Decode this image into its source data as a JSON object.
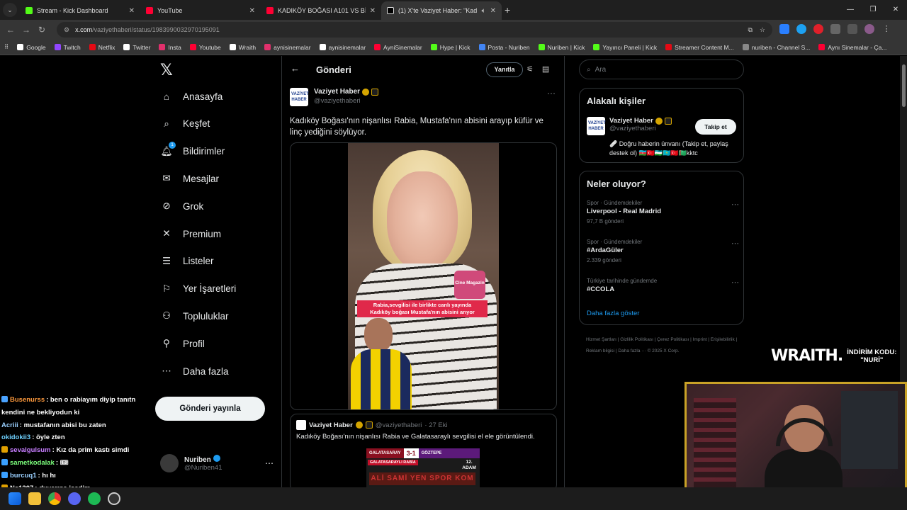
{
  "browser": {
    "tabs": [
      {
        "title": "Stream - Kick Dashboard",
        "color": "#53fc18"
      },
      {
        "title": "YouTube",
        "color": "#ff0033"
      },
      {
        "title": "KADIKÖY BOĞASI A101 VS BİM",
        "color": "#ff0033"
      },
      {
        "title": "(1) X'te Vaziyet Haber: \"Kadı",
        "color": "#ffffff"
      }
    ],
    "url_host": "x.com",
    "url_path": "/vaziyethaberi/status/1983990032970195091",
    "bookmarks": [
      {
        "label": "Google",
        "color": "#ffffff"
      },
      {
        "label": "Twitch",
        "color": "#9146ff"
      },
      {
        "label": "Netflix",
        "color": "#e50914"
      },
      {
        "label": "Twitter",
        "color": "#ffffff"
      },
      {
        "label": "Insta",
        "color": "#e1306c"
      },
      {
        "label": "Youtube",
        "color": "#ff0033"
      },
      {
        "label": "Wraith",
        "color": "#ffffff"
      },
      {
        "label": "aynisinemalar",
        "color": "#e1306c"
      },
      {
        "label": "aynisinemalar",
        "color": "#ffffff"
      },
      {
        "label": "AyniSinemalar",
        "color": "#ff0033"
      },
      {
        "label": "Hype | Kick",
        "color": "#53fc18"
      },
      {
        "label": "Posta - Nuriben",
        "color": "#4285f4"
      },
      {
        "label": "Nuriben | Kick",
        "color": "#53fc18"
      },
      {
        "label": "Yayıncı Paneli | Kick",
        "color": "#53fc18"
      },
      {
        "label": "Streamer Content M...",
        "color": "#e50914"
      },
      {
        "label": "nuriben - Channel S...",
        "color": "#888888"
      },
      {
        "label": "Aynı Sinemalar - Ça...",
        "color": "#ff0033"
      }
    ]
  },
  "left_nav": {
    "items": [
      {
        "label": "Anasayfa",
        "icon": "home-icon",
        "glyph": "⌂"
      },
      {
        "label": "Keşfet",
        "icon": "search-icon",
        "glyph": "⌕"
      },
      {
        "label": "Bildirimler",
        "icon": "bell-icon",
        "glyph": "🔔︎"
      },
      {
        "label": "Mesajlar",
        "icon": "mail-icon",
        "glyph": "✉"
      },
      {
        "label": "Grok",
        "icon": "grok-icon",
        "glyph": "⊘"
      },
      {
        "label": "Premium",
        "icon": "x-premium-icon",
        "glyph": "✕"
      },
      {
        "label": "Listeler",
        "icon": "list-icon",
        "glyph": "☰"
      },
      {
        "label": "Yer İşaretleri",
        "icon": "bookmark-icon",
        "glyph": "⚐"
      },
      {
        "label": "Topluluklar",
        "icon": "communities-icon",
        "glyph": "⚇"
      },
      {
        "label": "Profil",
        "icon": "profile-icon",
        "glyph": "⚲"
      },
      {
        "label": "Daha fazla",
        "icon": "more-circle-icon",
        "glyph": "⋯"
      }
    ],
    "notification_count": "1",
    "post_button": "Gönderi yayınla",
    "user": {
      "name": "Nuriben",
      "handle": "@Nuriben41"
    }
  },
  "post": {
    "header_title": "Gönderi",
    "reply_button": "Yanıtla",
    "author_name": "Vaziyet Haber",
    "author_handle": "@vaziyethaberi",
    "logo_text_1": "VAZİYET",
    "logo_text_2": "HABER",
    "text": "Kadıköy Boğası'nın nişanlısı Rabia, Mustafa'nın abisini arayıp küfür ve linç yediğini söylüyor.",
    "video_caption_1": "Rabia,sevgilisi ile birlikte canlı yayında",
    "video_caption_2": "Kadıköy boğası Mustafa'nın abisini arıyor",
    "video_logo": "Cine Magazin",
    "quoted": {
      "author_name": "Vaziyet Haber",
      "author_handle": "@vaziyethaberi",
      "date": "· 27 Eki",
      "text": "Kadıköy Boğası'nın nişanlısı Rabia ve Galatasaraylı sevgilisi el ele görüntülendi.",
      "home": "GALATASARAY",
      "score": "3-1",
      "away": "GÖZTEPE",
      "sub": "GALATASARAYLI RABİA",
      "adam": "12. ADAM",
      "banner": "ALİ SAMİ YEN SPOR KOM"
    }
  },
  "right": {
    "search_placeholder": "Ara",
    "related_title": "Alakalı kişiler",
    "related_name": "Vaziyet Haber",
    "related_handle": "@vaziyethaberi",
    "follow_button": "Takip et",
    "bio": "🩹 Doğru haberin ünvanı (Takip et, paylaş destek ol) 🇦🇿🇹🇷🇺🇿🇰🇿🇹🇷🇹🇲kktc",
    "trends_title": "Neler oluyor?",
    "trends": [
      {
        "context": "Spor · Gündemdekiler",
        "name": "Liverpool - Real Madrid",
        "count": "97,7 B gönderi"
      },
      {
        "context": "Spor · Gündemdekiler",
        "name": "#ArdaGüler",
        "count": "2.339 gönderi"
      },
      {
        "context": "Türkiye tarihinde gündemde",
        "name": "#CCOLA",
        "count": ""
      }
    ],
    "more_link": "Daha fazla göster",
    "footer": "Hizmet Şartları | Gizlilik Politikası | Çerez Politikası | Imprint | Erişilebilirlik | Reklam bilgisi | Daha fazla ··· © 2025 X Corp."
  },
  "chat": [
    {
      "user": "Busenurss",
      "msg": ": ben o rabiayım diyip tanıtn",
      "color": "#ff9a3c",
      "icon": "#4aa3ff"
    },
    {
      "user": "",
      "msg": "kendini ne bekliyodun ki",
      "color": "#ffffff",
      "icon": ""
    },
    {
      "user": "Acriii",
      "msg": ": mustafanın abisi bu zaten",
      "color": "#9ad0ff",
      "icon": ""
    },
    {
      "user": "okidokii3",
      "msg": ": öyle zten",
      "color": "#6fd1ff",
      "icon": ""
    },
    {
      "user": "sevalgulsum",
      "msg": ": Kız da prim kastı simdi",
      "color": "#c77dff",
      "icon": "#e0a000"
    },
    {
      "user": "sametkodalak",
      "msg": ": 🎟",
      "color": "#7cff7c",
      "icon": "#3aa0ff"
    },
    {
      "user": "burcuq1",
      "msg": ": hı hı",
      "color": "#9ad0ff",
      "icon": "#3aa0ff"
    },
    {
      "user": "Ns1307",
      "msg": ": duvarına işedim",
      "color": "#ffffff",
      "icon": "#e0a000"
    }
  ],
  "overlay": {
    "brand": "WRAITH.",
    "code_label": "İNDİRİM KODU:",
    "code": "\"NURİ\""
  }
}
